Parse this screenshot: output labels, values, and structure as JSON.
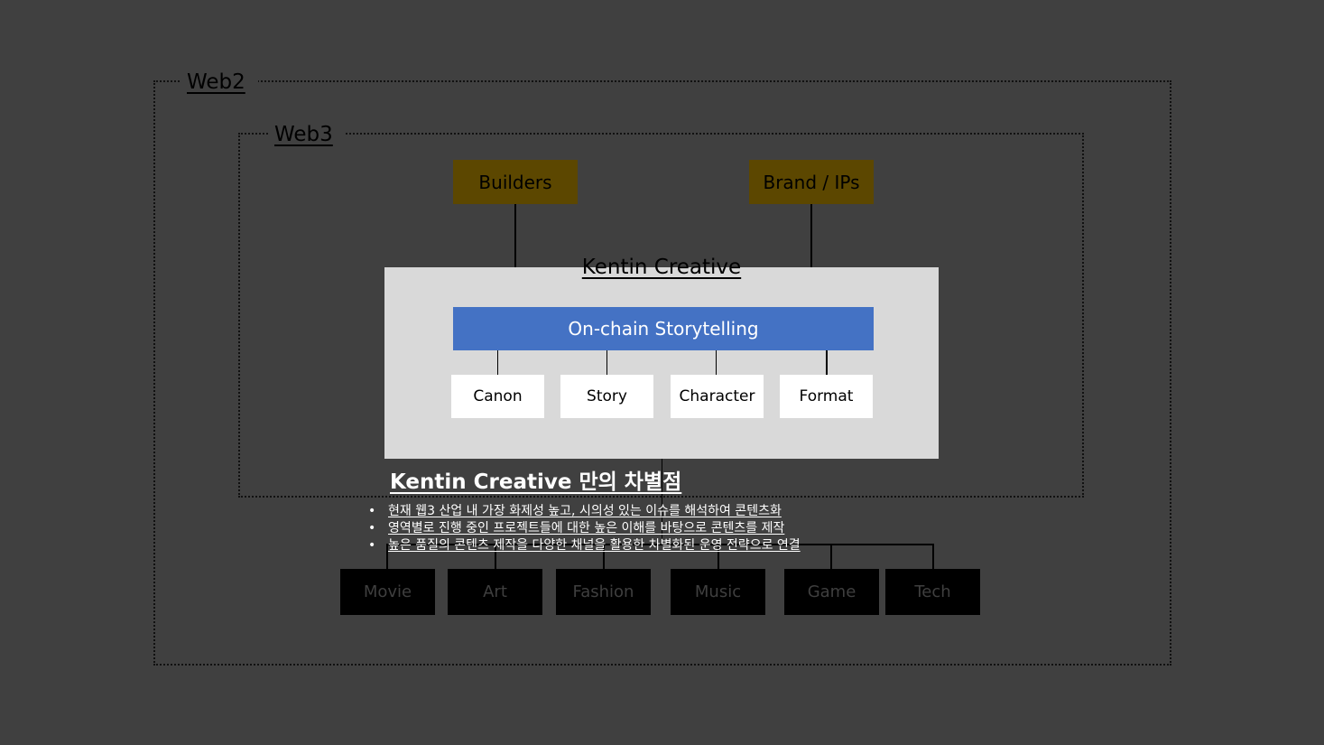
{
  "frames": {
    "outer_label": "Web2",
    "inner_label": "Web3"
  },
  "top_boxes": {
    "builders": "Builders",
    "brand": "Brand / IPs"
  },
  "kentin": {
    "title": "Kentin Creative",
    "storytelling": "On-chain Storytelling",
    "elements": [
      "Canon",
      "Story",
      "Character",
      "Format"
    ]
  },
  "differentiation": {
    "title": "Kentin Creative 만의 차별점",
    "bullet_symbol": "•",
    "points": [
      "현재 웹3 산업 내 가장 화제성 높고, 시의성 있는 이슈를 해석하여 콘텐츠화",
      "영역별로 진행 중인 프로젝트들에 대한 높은 이해를 바탕으로 콘텐츠를 제작",
      "높은 품질의 콘텐츠 제작을 다양한 채널을 활용한 차별화된 운영 전략으로 연결"
    ]
  },
  "channels": [
    "Movie",
    "Art",
    "Fashion",
    "Music",
    "Game",
    "Tech"
  ],
  "colors": {
    "background": "#404040",
    "gold_box": "#5c4700",
    "panel": "#d9d9d9",
    "storytelling_bar": "#4472c4",
    "channel_box": "#000000",
    "channel_text": "#3f3f3f"
  }
}
